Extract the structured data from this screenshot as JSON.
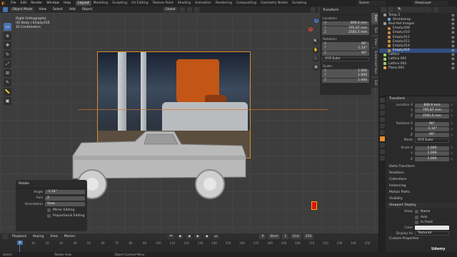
{
  "topbar": {
    "menus": [
      "File",
      "Edit",
      "Render",
      "Window",
      "Help"
    ],
    "workspaces": [
      "Layout",
      "Modeling",
      "Sculpting",
      "UV Editing",
      "Texture Paint",
      "Shading",
      "Animation",
      "Rendering",
      "Compositing",
      "Geometry Nodes",
      "Scripting"
    ],
    "active_workspace": "Layout",
    "scene": "Scene",
    "view_layer": "ViewLayer"
  },
  "viewport_header": {
    "mode": "Object Mode",
    "menus": [
      "View",
      "Select",
      "Add",
      "Object"
    ],
    "orientation": "Global",
    "options": "Options"
  },
  "viewport_info": {
    "view": "Right Orthographic",
    "object": "(0) Body | Empty.016",
    "scale": "10 Centimeters"
  },
  "gizmo": {
    "axes": [
      "X",
      "Y",
      "Z"
    ]
  },
  "n_panel": {
    "title": "Transform",
    "location_label": "Location:",
    "location": [
      {
        "axis": "X",
        "value": "806.6 mm"
      },
      {
        "axis": "Y",
        "value": "795.87 mm"
      },
      {
        "axis": "Z",
        "value": "2581.5 mm"
      }
    ],
    "rotation_label": "Rotation:",
    "rotation": [
      {
        "axis": "X",
        "value": "90°"
      },
      {
        "axis": "Y",
        "value": "-1.14°"
      },
      {
        "axis": "Z",
        "value": "90°"
      }
    ],
    "rotation_mode": "XYZ Euler",
    "scale_label": "Scale:",
    "scale": [
      {
        "axis": "X",
        "value": "1.000"
      },
      {
        "axis": "Y",
        "value": "1.000"
      },
      {
        "axis": "Z",
        "value": "1.000"
      }
    ]
  },
  "side_tabs": [
    "Item",
    "Tool",
    "View",
    "Screencast Keys",
    "Edit"
  ],
  "operator_panel": {
    "title": "Rotate",
    "angle_label": "Angle",
    "angle": "-1.14°",
    "axis_label": "Axis",
    "axis": "Z",
    "orientation_label": "Orientation",
    "orientation": "View",
    "mirror_label": "Mirror Editing",
    "proportional_label": "Proportional Editing"
  },
  "timeline": {
    "menus": [
      "Playback",
      "Keying",
      "View",
      "Marker"
    ],
    "current_frame": "0",
    "start_label": "Start",
    "start": "1",
    "end_label": "End",
    "end": "250",
    "ticks": [
      "0",
      "10",
      "20",
      "30",
      "40",
      "50",
      "60",
      "70",
      "80",
      "90",
      "100",
      "110",
      "120",
      "130",
      "140",
      "150",
      "160",
      "170",
      "180",
      "190",
      "200",
      "210",
      "220",
      "230",
      "240",
      "250"
    ]
  },
  "statusbar": {
    "items": [
      "Select",
      "Rotate View",
      "Object Context Menu"
    ]
  },
  "outliner": {
    "items": [
      {
        "name": "Temp 2",
        "indent": false,
        "color": "#9a9a9a"
      },
      {
        "name": "Shrinkwrap",
        "indent": true,
        "color": "#6aa0d8"
      },
      {
        "name": "Real Ref Images",
        "indent": false,
        "color": "#9a9a9a"
      },
      {
        "name": "Empty.008",
        "indent": true,
        "color": "#c88a3a"
      },
      {
        "name": "Empty.010",
        "indent": true,
        "color": "#c88a3a"
      },
      {
        "name": "Empty.011",
        "indent": true,
        "color": "#c88a3a"
      },
      {
        "name": "Empty.012",
        "indent": true,
        "color": "#c88a3a"
      },
      {
        "name": "Empty.014",
        "indent": true,
        "color": "#c88a3a"
      },
      {
        "name": "Empty.016",
        "indent": true,
        "color": "#c88a3a",
        "selected": true
      },
      {
        "name": "Lattice",
        "indent": false,
        "color": "#9fd066"
      },
      {
        "name": "Lattice.001",
        "indent": false,
        "color": "#9fd066"
      },
      {
        "name": "Lattice.002",
        "indent": false,
        "color": "#9fd066"
      },
      {
        "name": "Plane.001",
        "indent": false,
        "color": "#e8a046"
      }
    ]
  },
  "properties": {
    "transform_title": "Transform",
    "location": [
      {
        "label": "Location X",
        "value": "806.6 mm"
      },
      {
        "label": "Y",
        "value": "795.87 mm"
      },
      {
        "label": "Z",
        "value": "2581.5 mm"
      }
    ],
    "rotation": [
      {
        "label": "Rotation X",
        "value": "90°"
      },
      {
        "label": "Y",
        "value": "-1.14°"
      },
      {
        "label": "Z",
        "value": "90°"
      }
    ],
    "mode_label": "Mode",
    "mode": "XYZ Euler",
    "scale": [
      {
        "label": "Scale X",
        "value": "1.000"
      },
      {
        "label": "Y",
        "value": "1.000"
      },
      {
        "label": "Z",
        "value": "1.000"
      }
    ],
    "closed_sections": [
      "Delta Transform",
      "Relations",
      "Collections",
      "Instancing",
      "Motion Paths",
      "Visibility"
    ],
    "viewport_display_title": "Viewport Display",
    "show_label": "Show",
    "show_name": "Name",
    "show_axis": "Axis",
    "show_infront": "In Front",
    "color_label": "Color",
    "display_as_label": "Display As",
    "display_as": "Textured",
    "custom_properties": "Custom Properties"
  },
  "watermark": "Udemy"
}
